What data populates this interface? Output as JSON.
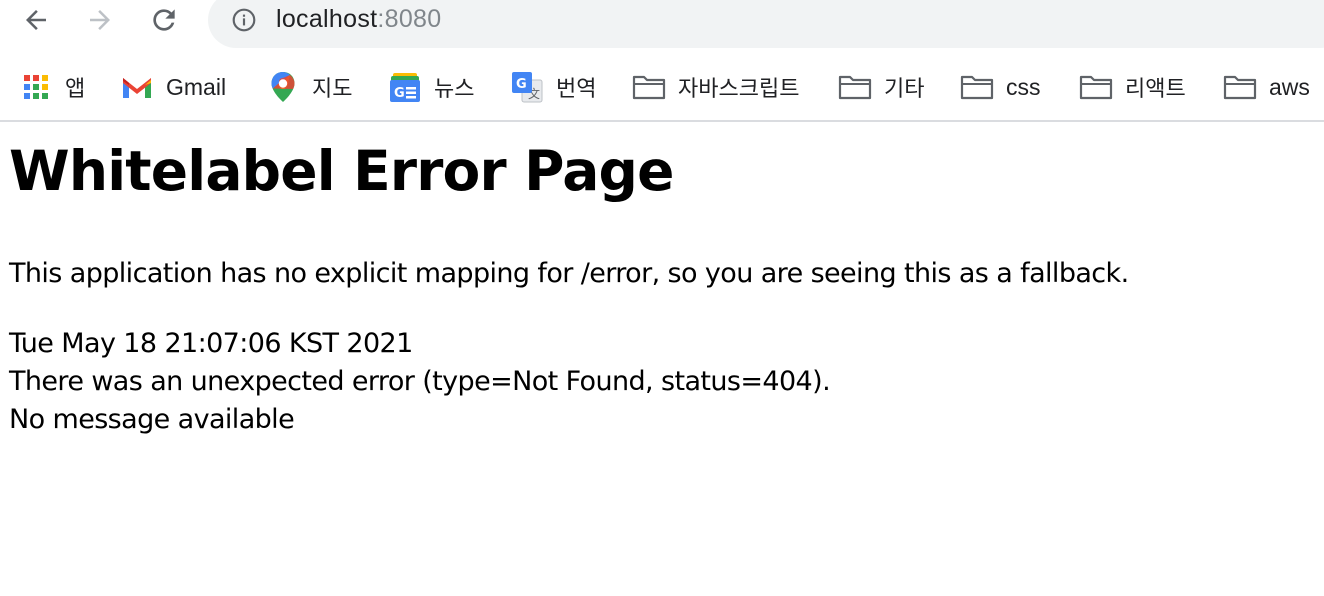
{
  "browser": {
    "address_bar": {
      "host": "localhost",
      "port": ":8080"
    },
    "nav": {
      "back_icon": "arrow-back-icon",
      "forward_icon": "arrow-forward-icon",
      "reload_icon": "reload-icon",
      "info_icon": "info-icon"
    },
    "bookmarks": [
      {
        "label": "앱",
        "icon": "apps-grid-icon"
      },
      {
        "label": "Gmail",
        "icon": "gmail-icon"
      },
      {
        "label": "지도",
        "icon": "maps-pin-icon"
      },
      {
        "label": "뉴스",
        "icon": "google-news-icon"
      },
      {
        "label": "번역",
        "icon": "google-translate-icon"
      },
      {
        "label": "자바스크립트",
        "icon": "folder-icon"
      },
      {
        "label": "기타",
        "icon": "folder-icon"
      },
      {
        "label": "css",
        "icon": "folder-icon"
      },
      {
        "label": "리액트",
        "icon": "folder-icon"
      },
      {
        "label": "aws",
        "icon": "folder-icon"
      }
    ]
  },
  "page": {
    "title": "Whitelabel Error Page",
    "description": "This application has no explicit mapping for /error, so you are seeing this as a fallback.",
    "timestamp": "Tue May 18 21:07:06 KST 2021",
    "error_line": "There was an unexpected error (type=Not Found, status=404).",
    "message": "No message available"
  }
}
